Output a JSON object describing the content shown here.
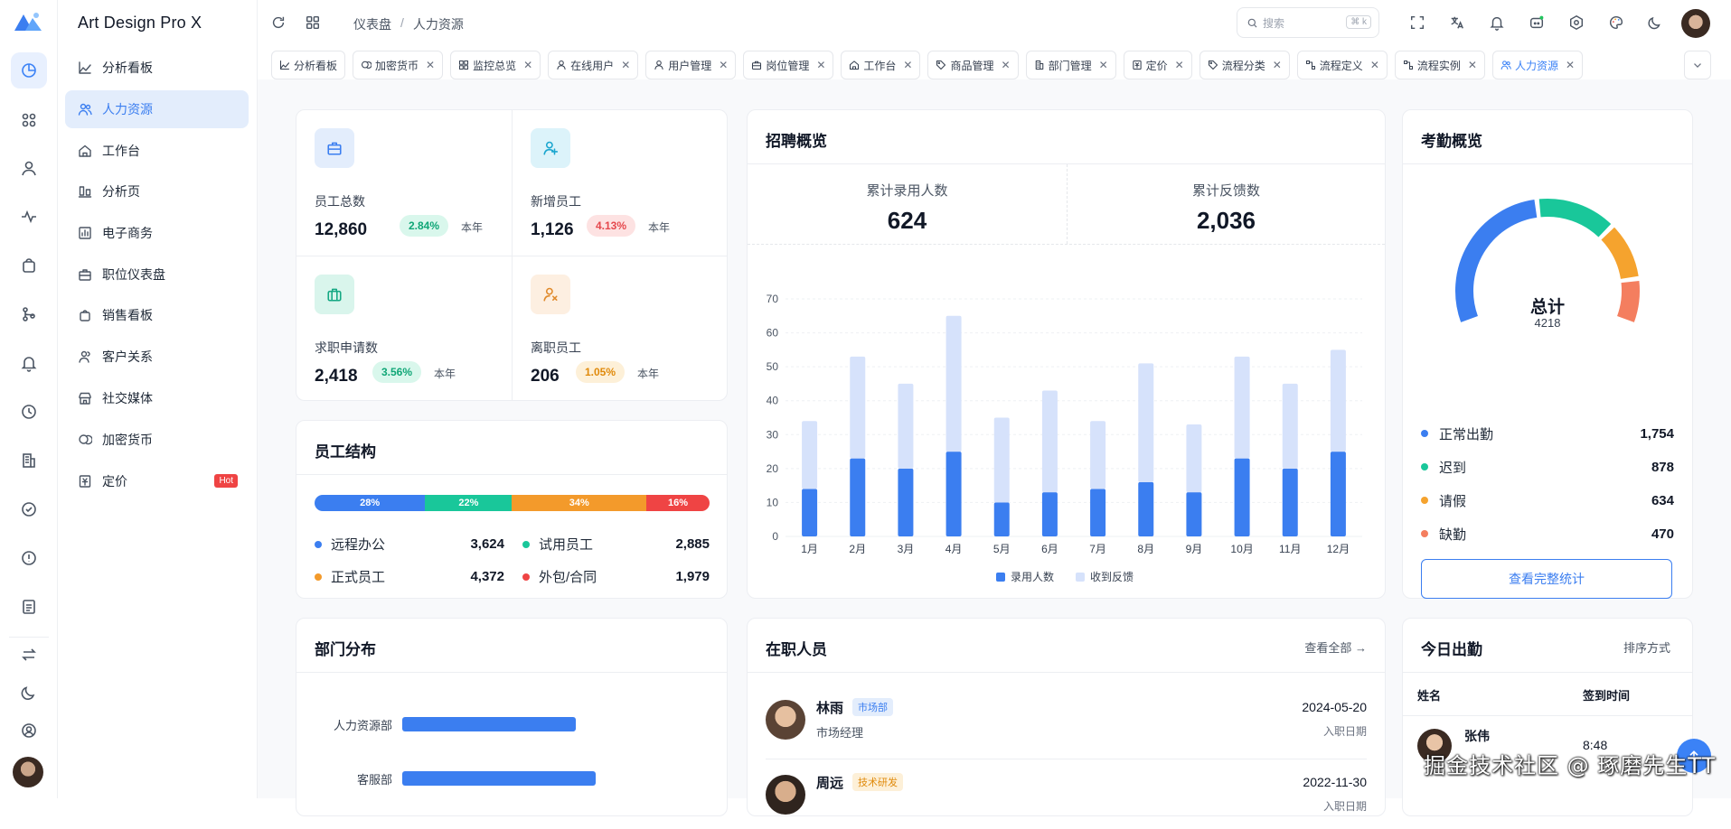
{
  "app": {
    "title": "Art Design Pro X"
  },
  "menu": {
    "items": [
      {
        "label": "分析看板",
        "icon": "chart-line-icon"
      },
      {
        "label": "人力资源",
        "icon": "users-icon"
      },
      {
        "label": "工作台",
        "icon": "home-icon"
      },
      {
        "label": "分析页",
        "icon": "bar-chart-icon"
      },
      {
        "label": "电子商务",
        "icon": "stats-icon"
      },
      {
        "label": "职位仪表盘",
        "icon": "briefcase-icon"
      },
      {
        "label": "销售看板",
        "icon": "bag-icon"
      },
      {
        "label": "客户关系",
        "icon": "user-group-icon"
      },
      {
        "label": "社交媒体",
        "icon": "store-icon"
      },
      {
        "label": "加密货币",
        "icon": "coins-icon"
      },
      {
        "label": "定价",
        "icon": "price-icon",
        "badge": "Hot"
      }
    ]
  },
  "breadcrumb": {
    "items": [
      "仪表盘",
      "/",
      "人力资源"
    ]
  },
  "search": {
    "placeholder": "搜索",
    "shortcut": "⌘ k"
  },
  "tabs": [
    {
      "label": "分析看板",
      "icon": "chart-line-icon",
      "closable": false
    },
    {
      "label": "加密货币",
      "icon": "coins-icon",
      "closable": true
    },
    {
      "label": "监控总览",
      "icon": "grid-icon",
      "closable": true
    },
    {
      "label": "在线用户",
      "icon": "user-icon",
      "closable": true
    },
    {
      "label": "用户管理",
      "icon": "user-icon",
      "closable": true
    },
    {
      "label": "岗位管理",
      "icon": "briefcase-icon",
      "closable": true
    },
    {
      "label": "工作台",
      "icon": "home-icon",
      "closable": true
    },
    {
      "label": "商品管理",
      "icon": "tag-icon",
      "closable": true
    },
    {
      "label": "部门管理",
      "icon": "building-icon",
      "closable": true
    },
    {
      "label": "定价",
      "icon": "price-icon",
      "closable": true
    },
    {
      "label": "流程分类",
      "icon": "tag-icon",
      "closable": true
    },
    {
      "label": "流程定义",
      "icon": "flow-icon",
      "closable": true
    },
    {
      "label": "流程实例",
      "icon": "flow-icon",
      "closable": true
    },
    {
      "label": "人力资源",
      "icon": "users-icon",
      "closable": true,
      "active": true
    }
  ],
  "stats": [
    {
      "label": "员工总数",
      "value": "12,860",
      "change": "2.84%",
      "period": "本年",
      "tone": "green",
      "icon": "briefcase-icon"
    },
    {
      "label": "新增员工",
      "value": "1,126",
      "change": "4.13%",
      "period": "本年",
      "tone": "red",
      "icon": "user-plus-icon"
    },
    {
      "label": "求职申请数",
      "value": "2,418",
      "change": "3.56%",
      "period": "本年",
      "tone": "green",
      "icon": "suitcase-icon"
    },
    {
      "label": "离职员工",
      "value": "206",
      "change": "1.05%",
      "period": "本年",
      "tone": "orange",
      "icon": "user-x-icon"
    }
  ],
  "structure": {
    "title": "员工结构",
    "segments": [
      {
        "label": "28%",
        "color": "#3b7ef0",
        "pct": 28
      },
      {
        "label": "22%",
        "color": "#19c79a",
        "pct": 22
      },
      {
        "label": "34%",
        "color": "#f39a2b",
        "pct": 34
      },
      {
        "label": "16%",
        "color": "#ef4444",
        "pct": 16
      }
    ],
    "legend": [
      {
        "name": "远程办公",
        "value": "3,624",
        "color": "#3b7ef0"
      },
      {
        "name": "试用员工",
        "value": "2,885",
        "color": "#19c79a"
      },
      {
        "name": "正式员工",
        "value": "4,372",
        "color": "#f39a2b"
      },
      {
        "name": "外包/合同",
        "value": "1,979",
        "color": "#ef4444"
      }
    ]
  },
  "recruit": {
    "title": "招聘概览",
    "kpis": [
      {
        "label": "累计录用人数",
        "value": "624"
      },
      {
        "label": "累计反馈数",
        "value": "2,036"
      }
    ]
  },
  "chart_data": {
    "type": "bar",
    "stacked": true,
    "categories": [
      "1月",
      "2月",
      "3月",
      "4月",
      "5月",
      "6月",
      "7月",
      "8月",
      "9月",
      "10月",
      "11月",
      "12月"
    ],
    "series": [
      {
        "name": "录用人数",
        "color": "#3b7ef0",
        "values": [
          14,
          23,
          20,
          25,
          10,
          13,
          14,
          16,
          13,
          23,
          20,
          25
        ]
      },
      {
        "name": "收到反馈",
        "color": "#d6e2fb",
        "values": [
          20,
          30,
          25,
          40,
          25,
          30,
          20,
          35,
          20,
          30,
          25,
          30
        ]
      }
    ],
    "ylim": [
      0,
      70
    ],
    "yticks": [
      "0",
      "10",
      "20",
      "30",
      "40",
      "50",
      "60",
      "70"
    ],
    "legend_position": "bottom",
    "grid": true
  },
  "attendance": {
    "title": "考勤概览",
    "total_label": "总计",
    "total_value": "4218",
    "items": [
      {
        "name": "正常出勤",
        "value": "1,754",
        "num": 1754,
        "color": "#3b7ef0"
      },
      {
        "name": "迟到",
        "value": "878",
        "num": 878,
        "color": "#19c79a"
      },
      {
        "name": "请假",
        "value": "634",
        "num": 634,
        "color": "#f5a32e"
      },
      {
        "name": "缺勤",
        "value": "470",
        "num": 470,
        "color": "#f47e5f"
      }
    ],
    "button": "查看完整统计"
  },
  "dept": {
    "title": "部门分布",
    "rows": [
      {
        "name": "人力资源部",
        "value": 0.44
      },
      {
        "name": "客服部",
        "value": 0.49
      }
    ]
  },
  "employees": {
    "title": "在职人员",
    "view_all": "查看全部 →",
    "rows": [
      {
        "name": "林雨",
        "tag": "市场部",
        "tag_tone": "blue",
        "role": "市场经理",
        "date": "2024-05-20",
        "sub": "入职日期"
      },
      {
        "name": "周远",
        "tag": "技术研发",
        "tag_tone": "orange",
        "role": "",
        "date": "2022-11-30",
        "sub": "入职日期"
      }
    ]
  },
  "today": {
    "title": "今日出勤",
    "sort": "排序方式",
    "headers": [
      "姓名",
      "签到时间"
    ],
    "rows": [
      {
        "name": "张伟",
        "time": "8:48"
      }
    ]
  },
  "watermark": "掘金技术社区 @ 琢磨先生TT"
}
